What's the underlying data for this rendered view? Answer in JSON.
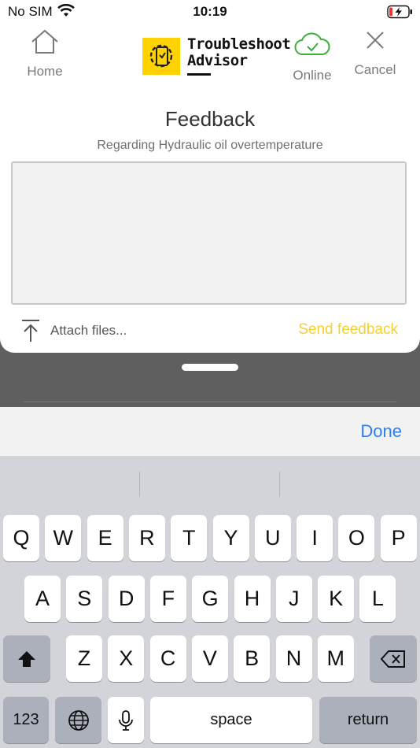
{
  "status_bar": {
    "carrier": "No SIM",
    "time": "10:19"
  },
  "header": {
    "home_label": "Home",
    "app_name_line1": "Troubleshoot",
    "app_name_line2": "Advisor",
    "online_label": "Online",
    "cancel_label": "Cancel"
  },
  "feedback": {
    "title": "Feedback",
    "subtitle": "Regarding Hydraulic oil overtemperature",
    "text_value": "",
    "attach_label": "Attach files...",
    "send_label": "Send feedback"
  },
  "accessory": {
    "done_label": "Done"
  },
  "keyboard": {
    "row1": [
      "Q",
      "W",
      "E",
      "R",
      "T",
      "Y",
      "U",
      "I",
      "O",
      "P"
    ],
    "row2": [
      "A",
      "S",
      "D",
      "F",
      "G",
      "H",
      "J",
      "K",
      "L"
    ],
    "row3": [
      "Z",
      "X",
      "C",
      "V",
      "B",
      "N",
      "M"
    ],
    "numbers_label": "123",
    "space_label": "space",
    "return_label": "return"
  },
  "colors": {
    "accent_yellow": "#f5d230",
    "online_green": "#3cae3c",
    "done_blue": "#2f7ef0",
    "logo_yellow": "#ffd200"
  }
}
